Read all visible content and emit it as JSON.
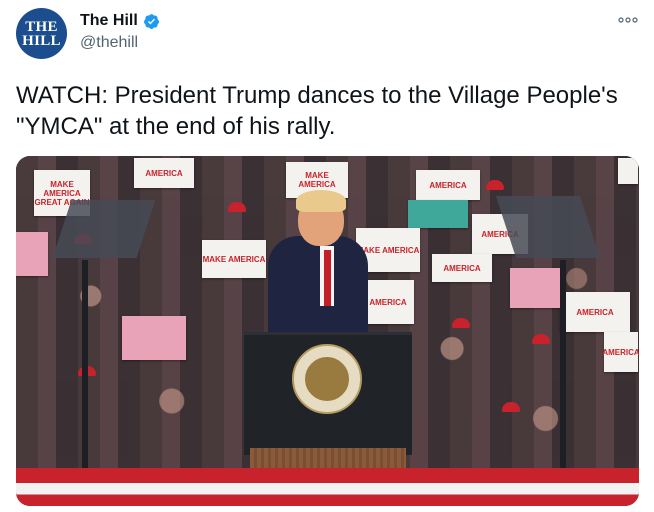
{
  "account": {
    "avatar_line1": "THE",
    "avatar_line2": "HILL",
    "display_name": "The Hill",
    "handle": "@thehill",
    "verified": true
  },
  "tweet": {
    "text": "WATCH: President Trump dances to the Village People's \"YMCA\" at the end of his rally."
  },
  "media": {
    "signs": [
      "MAKE AMERICA GREAT AGAIN",
      "AMERICA",
      "MAKE AMERICA",
      "AMERICA",
      "MAKE AMERICA",
      "MAKE AMERICA",
      "AMERICA",
      "AMERICA",
      "AMERICA",
      "AMERICA",
      "AMERICA"
    ]
  },
  "colors": {
    "verified_blue": "#1d9bf0",
    "avatar_bg": "#1b4d8f",
    "handle_gray": "#536471",
    "maga_red": "#c8232c"
  },
  "icons": {
    "verified": "verified-badge-icon",
    "more": "more-options-icon",
    "seal": "presidential-seal-icon"
  }
}
